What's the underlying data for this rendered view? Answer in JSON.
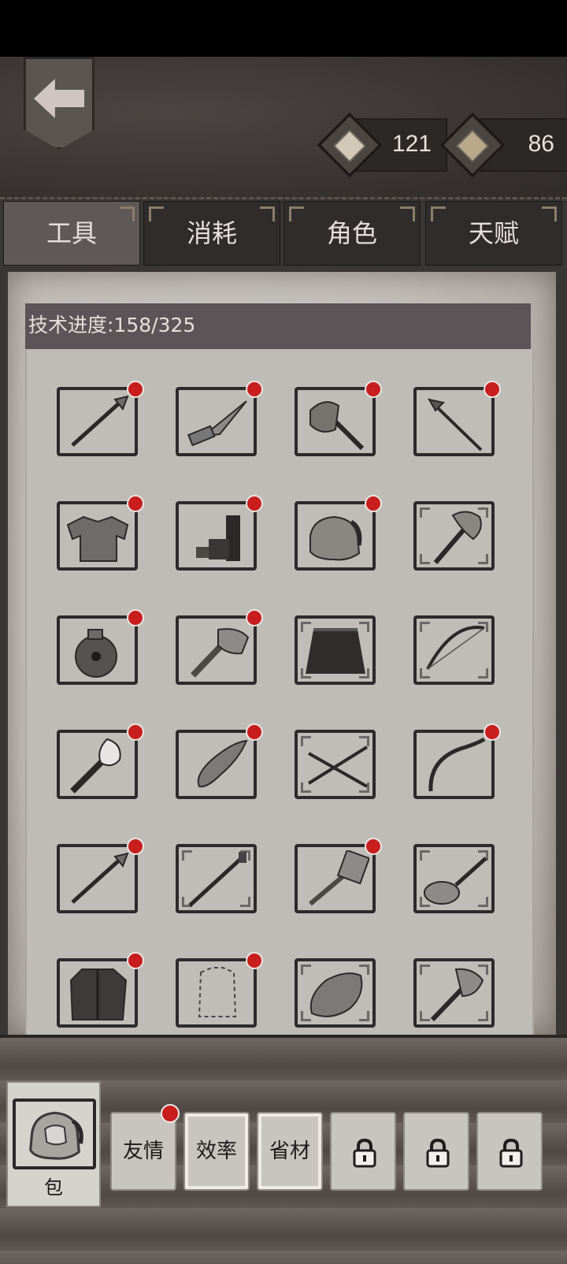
{
  "currency": [
    {
      "icon": "scroll-icon",
      "value": "121"
    },
    {
      "icon": "book-icon",
      "value": "86"
    }
  ],
  "tabs": [
    {
      "label": "工具",
      "active": true
    },
    {
      "label": "消耗",
      "active": false
    },
    {
      "label": "角色",
      "active": false
    },
    {
      "label": "天赋",
      "active": false
    }
  ],
  "progress": {
    "label": "技术进度:158/325",
    "current": 158,
    "total": 325
  },
  "items": [
    {
      "name": "spear-icon",
      "badge": true
    },
    {
      "name": "knife-icon",
      "badge": true
    },
    {
      "name": "stone-axe-icon",
      "badge": true
    },
    {
      "name": "harpoon-icon",
      "badge": true
    },
    {
      "name": "chainmail-armor-icon",
      "badge": true
    },
    {
      "name": "dynamite-icon",
      "badge": true
    },
    {
      "name": "backpack-icon",
      "badge": true
    },
    {
      "name": "battle-axe-icon",
      "badge": false
    },
    {
      "name": "poison-bomb-icon",
      "badge": true
    },
    {
      "name": "stone-hammer-icon",
      "badge": true
    },
    {
      "name": "skirt-icon",
      "badge": false
    },
    {
      "name": "bow-icon",
      "badge": false
    },
    {
      "name": "torch-icon",
      "badge": true
    },
    {
      "name": "stone-blade-icon",
      "badge": true
    },
    {
      "name": "arrows-icon",
      "badge": false
    },
    {
      "name": "recurve-bow-icon",
      "badge": true
    },
    {
      "name": "spear-icon",
      "badge": true
    },
    {
      "name": "staff-icon",
      "badge": false
    },
    {
      "name": "sledgehammer-icon",
      "badge": true
    },
    {
      "name": "pan-icon",
      "badge": false
    },
    {
      "name": "vest-icon",
      "badge": true
    },
    {
      "name": "shirt-outline-icon",
      "badge": true
    },
    {
      "name": "stone-icon",
      "badge": false
    },
    {
      "name": "axe-icon",
      "badge": false
    }
  ],
  "bag": {
    "label": "包"
  },
  "skills": [
    {
      "label": "友情",
      "badge": true,
      "locked": false
    },
    {
      "label": "效率",
      "badge": false,
      "locked": false
    },
    {
      "label": "省材",
      "badge": false,
      "locked": false
    },
    {
      "label": "",
      "badge": false,
      "locked": true
    },
    {
      "label": "",
      "badge": false,
      "locked": true
    },
    {
      "label": "",
      "badge": false,
      "locked": true
    }
  ]
}
